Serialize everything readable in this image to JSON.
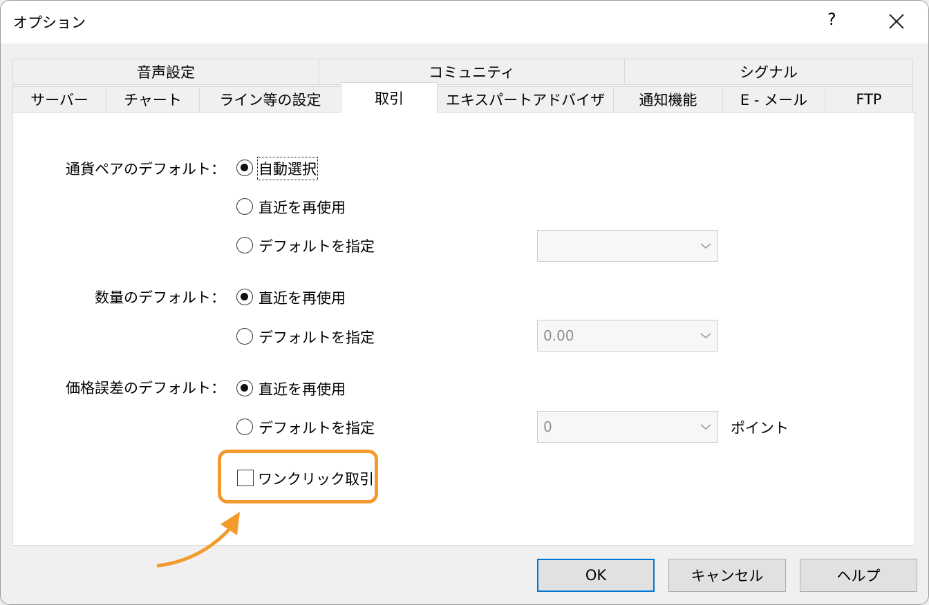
{
  "window": {
    "title": "オプション",
    "help": "?"
  },
  "tabs_row1": [
    "音声設定",
    "コミュニティ",
    "シグナル"
  ],
  "tabs_row2": [
    "サーバー",
    "チャート",
    "ライン等の設定",
    "取引",
    "エキスパートアドバイザ",
    "通知機能",
    "E - メール",
    "FTP"
  ],
  "active_tab": "取引",
  "trading": {
    "pair_label": "通貨ペアのデフォルト：",
    "pair_opt1": "自動選択",
    "pair_opt2": "直近を再使用",
    "pair_opt3": "デフォルトを指定",
    "pair_combo_value": "",
    "volume_label": "数量のデフォルト：",
    "volume_opt1": "直近を再使用",
    "volume_opt2": "デフォルトを指定",
    "volume_combo_value": "0.00",
    "slip_label": "価格誤差のデフォルト：",
    "slip_opt1": "直近を再使用",
    "slip_opt2": "デフォルトを指定",
    "slip_combo_value": "0",
    "slip_unit": "ポイント",
    "oneclick_label": "ワンクリック取引",
    "oneclick_checked": false
  },
  "buttons": {
    "ok": "OK",
    "cancel": "キャンセル",
    "help": "ヘルプ"
  },
  "colors": {
    "highlight": "#f39a2d",
    "default_button_border": "#0078d7"
  }
}
